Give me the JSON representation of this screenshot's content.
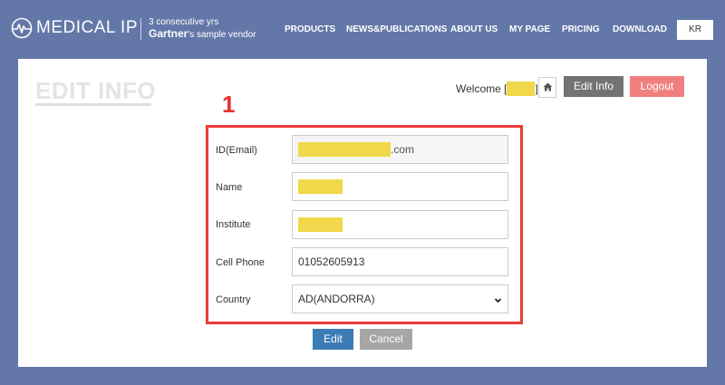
{
  "header": {
    "logo_text": "MEDICAL IP",
    "tagline_line1": "3 consecutive yrs",
    "tagline_brand": "Gartner",
    "tagline_rest": "'s sample vendor",
    "nav": [
      "PRODUCTS",
      "NEWS&PUBLICATIONS",
      "ABOUT US",
      "MY PAGE",
      "PRICING",
      "DOWNLOAD"
    ],
    "language_button": "KR"
  },
  "page": {
    "title": "EDIT INFO",
    "welcome_prefix": "Welcome [",
    "welcome_suffix": "]",
    "edit_info_button": "Edit Info",
    "logout_button": "Logout"
  },
  "annotation": {
    "number": "1",
    "color": "#ec3a34"
  },
  "form": {
    "id_label": "ID(Email)",
    "id_suffix": ".com",
    "name_label": "Name",
    "institute_label": "Institute",
    "phone_label": "Cell Phone",
    "phone_value": "01052605913",
    "country_label": "Country",
    "country_value": "AD(ANDORRA)",
    "submit_button": "Edit",
    "cancel_button": "Cancel"
  },
  "colors": {
    "background": "#6378a8",
    "redaction": "#f0d84a",
    "edit_button": "#3b7cb5",
    "logout_button": "#f27f7f"
  }
}
